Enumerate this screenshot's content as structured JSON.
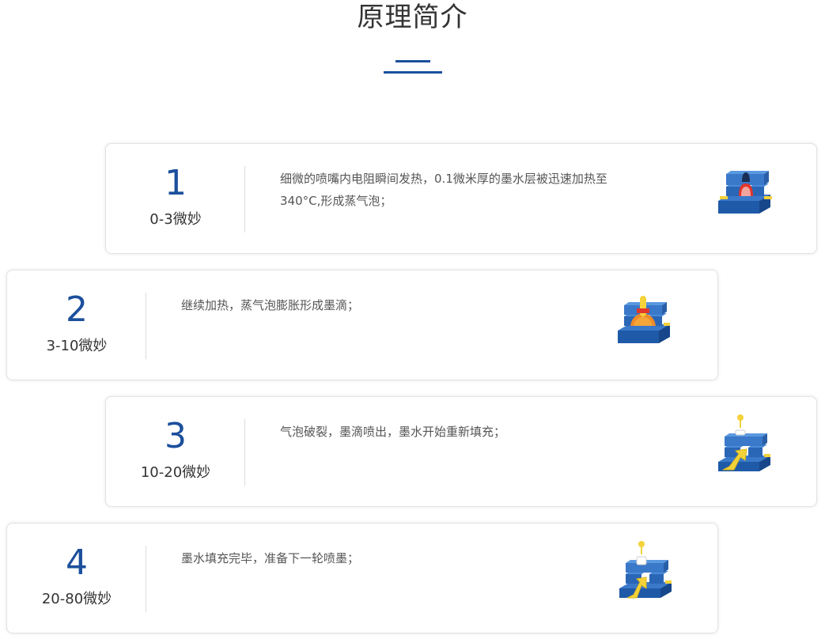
{
  "header": {
    "title": "原理简介"
  },
  "colors": {
    "accent": "#1b4f9c",
    "text": "#333333",
    "desc_text": "#555555",
    "card_border": "#e3e3e3"
  },
  "steps": [
    {
      "number": "1",
      "time": "0-3微妙",
      "description": "细微的喷嘴内电阻瞬间发热，0.1微米厚的墨水层被迅速加热至340°C,形成蒸气泡；",
      "icon": "nozzle-heating-icon"
    },
    {
      "number": "2",
      "time": "3-10微妙",
      "description": "继续加热，蒸气泡膨胀形成墨滴；",
      "icon": "bubble-expanding-icon"
    },
    {
      "number": "3",
      "time": "10-20微妙",
      "description": "气泡破裂，墨滴喷出，墨水开始重新填充；",
      "icon": "droplet-ejecting-icon"
    },
    {
      "number": "4",
      "time": "20-80微妙",
      "description": "墨水填充完毕，准备下一轮喷墨；",
      "icon": "ink-refill-icon"
    }
  ]
}
